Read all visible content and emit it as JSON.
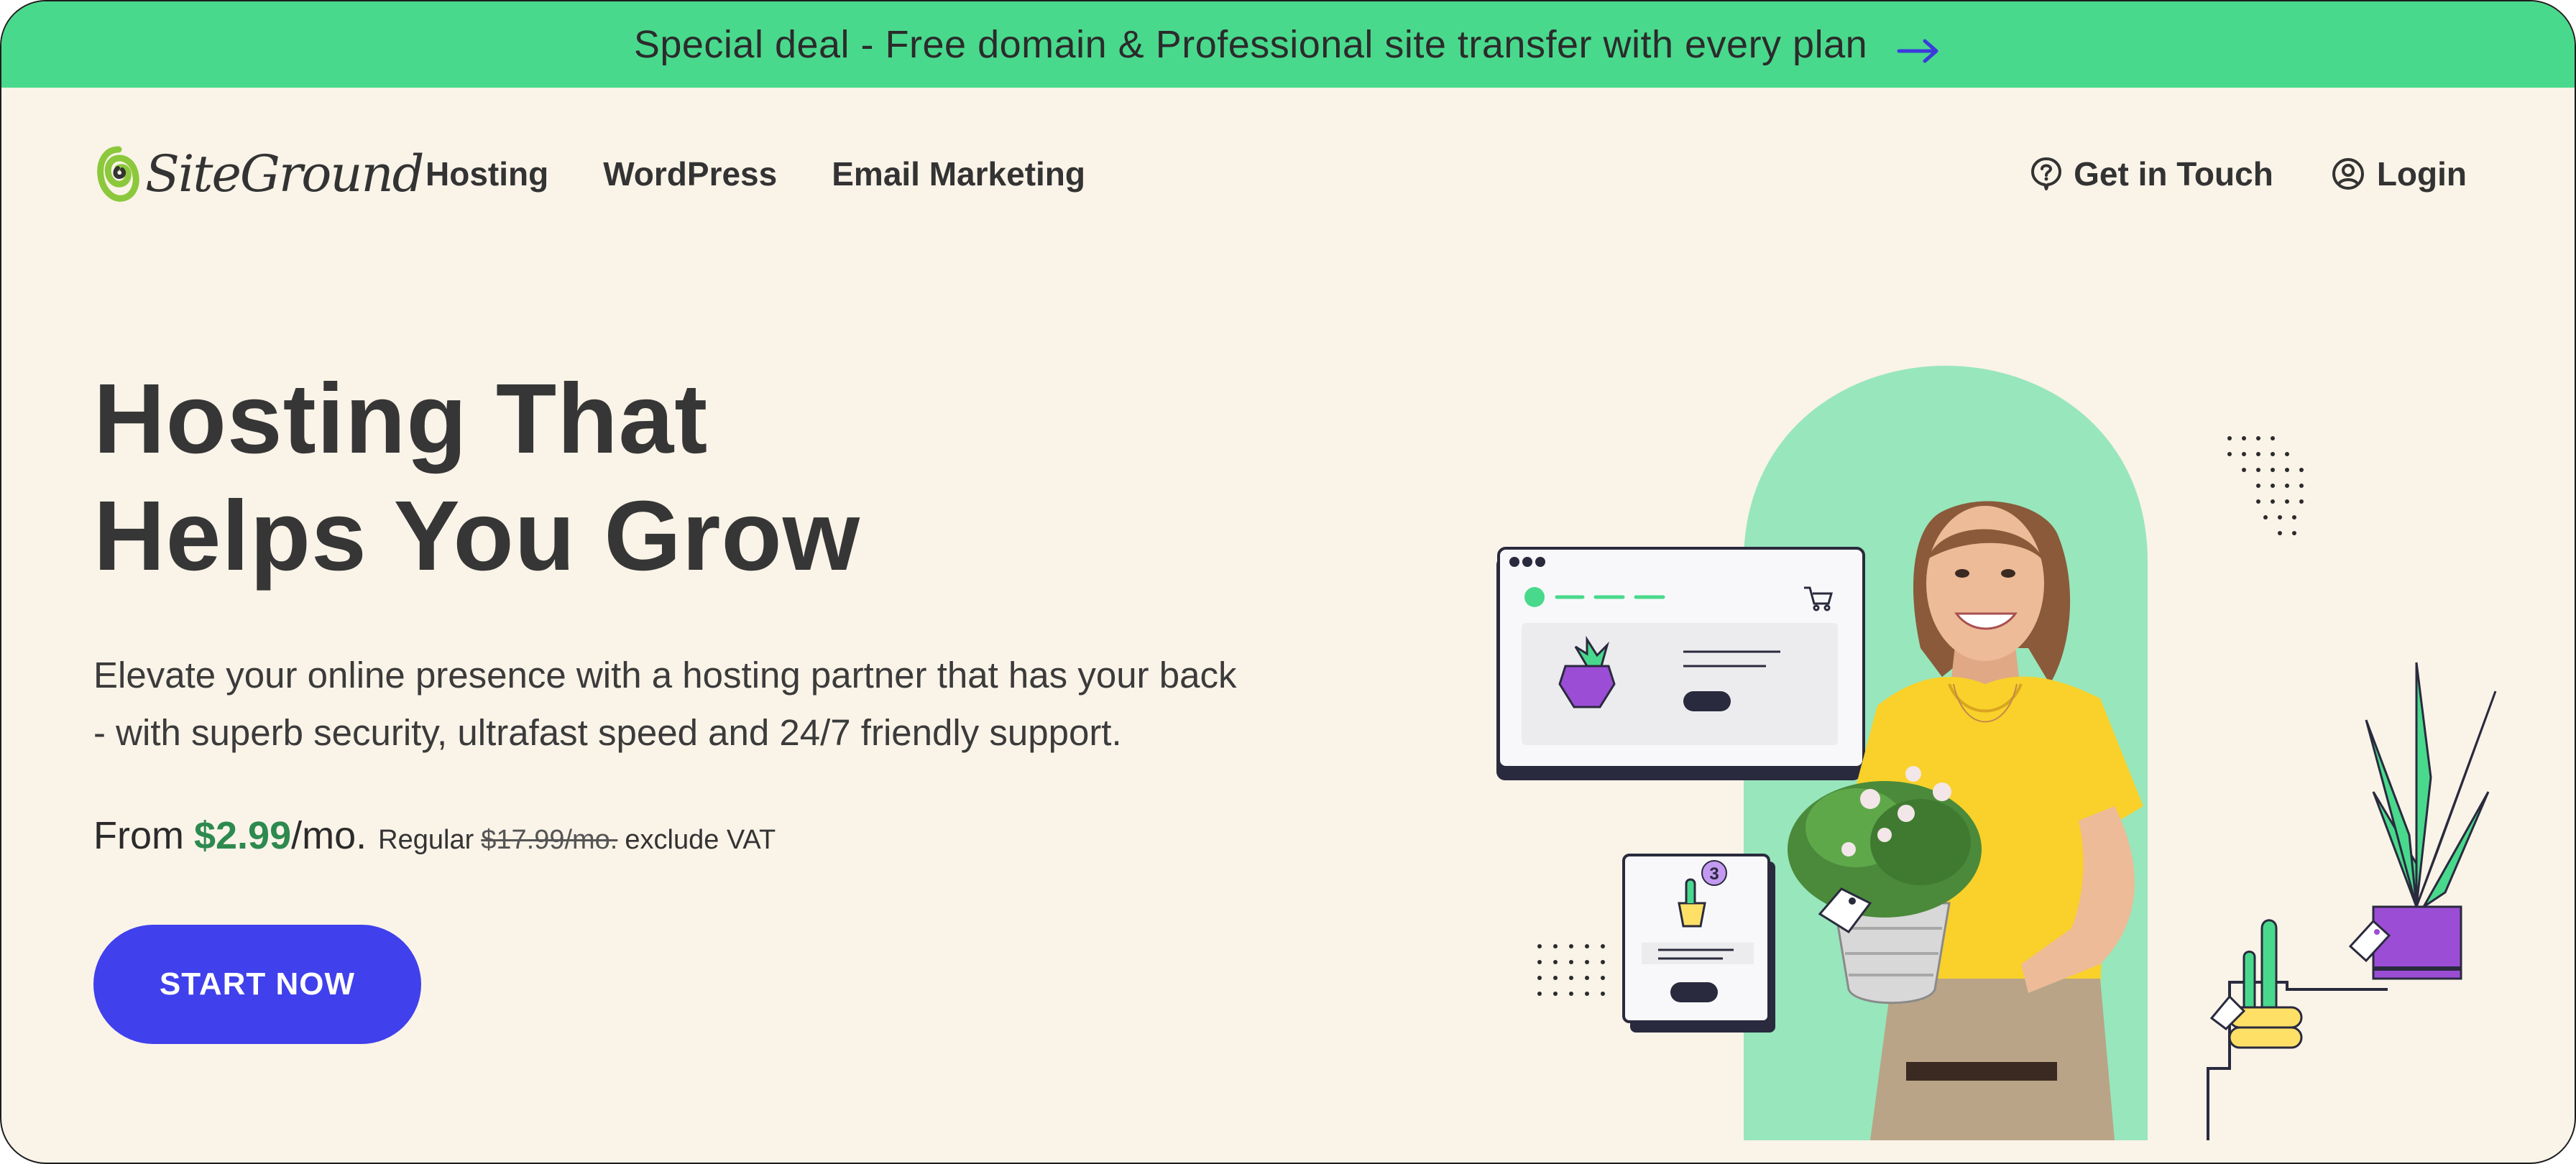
{
  "banner": {
    "text": "Special deal - Free domain & Professional site transfer with every plan",
    "icon": "arrow-right-icon"
  },
  "nav": {
    "logo_text": "SiteGround",
    "links": [
      "Hosting",
      "WordPress",
      "Email Marketing"
    ],
    "get_in_touch": "Get in Touch",
    "login": "Login"
  },
  "hero": {
    "title_line1": "Hosting That",
    "title_line2": "Helps You Grow",
    "subtitle_line1": "Elevate your online presence with a hosting partner that has your back",
    "subtitle_line2": "- with superb security, ultrafast speed and 24/7 friendly support.",
    "price_from": "From",
    "price_amount": "$2.99",
    "price_unit": "/mo.",
    "regular_label": "Regular",
    "regular_price": "$17.99/mo.",
    "vat_note": "exclude VAT",
    "cta": "START NOW"
  },
  "illustration": {
    "cart_badge": "3"
  },
  "colors": {
    "banner_bg": "#49d98c",
    "page_bg": "#faf3e8",
    "cta_bg": "#4040ec",
    "price_green": "#2d8a4e",
    "text_dark": "#363636",
    "arch_green": "#98e6bc"
  }
}
